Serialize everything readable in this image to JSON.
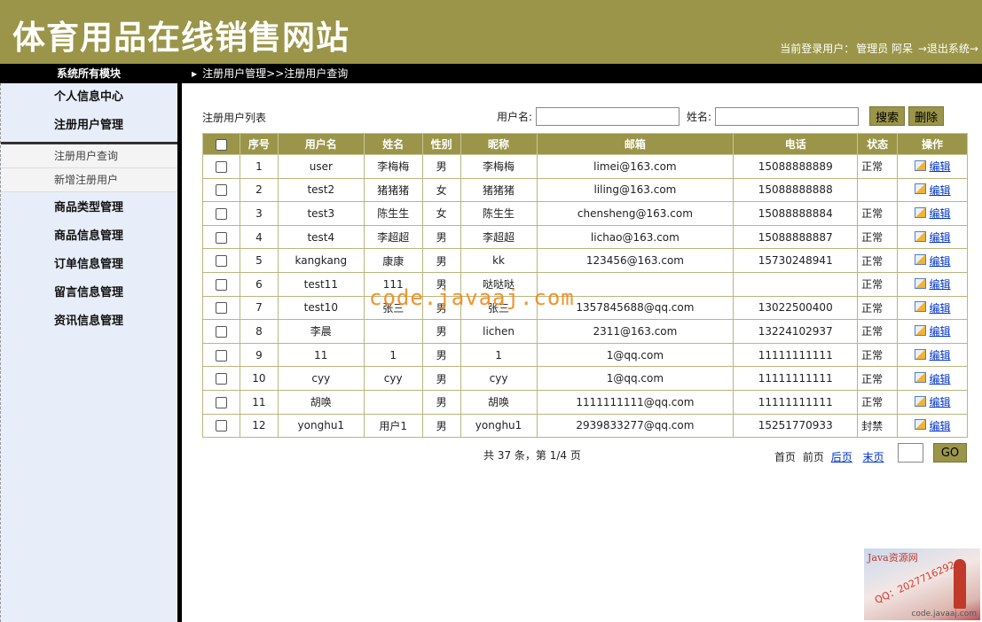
{
  "app": {
    "title": "体育用品在线销售网站",
    "login_label": "当前登录用户：",
    "login_user": "管理员 阿呆",
    "logout": "→退出系统→"
  },
  "nav": {
    "module_title": "系统所有模块",
    "breadcrumb": "注册用户管理>>注册用户查询"
  },
  "sidebar": {
    "groups_top": [
      "个人信息中心",
      "注册用户管理"
    ],
    "sub_items": [
      "注册用户查询",
      "新增注册用户"
    ],
    "groups_bottom": [
      "商品类型管理",
      "商品信息管理",
      "订单信息管理",
      "留言信息管理",
      "资讯信息管理"
    ]
  },
  "main": {
    "list_title": "注册用户列表",
    "search_username_label": "用户名:",
    "search_name_label": "姓名:",
    "search_username_value": "",
    "search_name_value": "",
    "search_button": "搜索",
    "delete_button": "删除"
  },
  "table": {
    "headers": [
      "",
      "序号",
      "用户名",
      "姓名",
      "性别",
      "昵称",
      "邮箱",
      "电话",
      "状态",
      "操作"
    ],
    "edit_label": "编辑",
    "rows": [
      [
        "1",
        "user",
        "李梅梅",
        "男",
        "李梅梅",
        "limei@163.com",
        "15088888889",
        "正常"
      ],
      [
        "2",
        "test2",
        "猪猪猪",
        "女",
        "猪猪猪",
        "liling@163.com",
        "15088888888",
        ""
      ],
      [
        "3",
        "test3",
        "陈生生",
        "女",
        "陈生生",
        "chensheng@163.com",
        "15088888884",
        "正常"
      ],
      [
        "4",
        "test4",
        "李超超",
        "男",
        "李超超",
        "lichao@163.com",
        "15088888887",
        "正常"
      ],
      [
        "5",
        "kangkang",
        "康康",
        "男",
        "kk",
        "123456@163.com",
        "15730248941",
        "正常"
      ],
      [
        "6",
        "test11",
        "111",
        "男",
        "哒哒哒",
        "",
        "",
        "正常"
      ],
      [
        "7",
        "test10",
        "张三",
        "男",
        "张三",
        "1357845688@qq.com",
        "13022500400",
        "正常"
      ],
      [
        "8",
        "李晨",
        "",
        "男",
        "lichen",
        "2311@163.com",
        "13224102937",
        "正常"
      ],
      [
        "9",
        "11",
        "1",
        "男",
        "1",
        "1@qq.com",
        "11111111111",
        "正常"
      ],
      [
        "10",
        "cyy",
        "cyy",
        "男",
        "cyy",
        "1@qq.com",
        "11111111111",
        "正常"
      ],
      [
        "11",
        "胡唤",
        "",
        "男",
        "胡唤",
        "1111111111@qq.com",
        "11111111111",
        "正常"
      ],
      [
        "12",
        "yonghu1",
        "用户1",
        "男",
        "yonghu1",
        "2939833277@qq.com",
        "15251770933",
        "封禁"
      ]
    ]
  },
  "pager": {
    "summary": "共 37 条，第 1/4 页",
    "first": "首页",
    "prev": "前页",
    "next": "后页",
    "last": "末页",
    "page_input_value": "",
    "go": "GO"
  },
  "watermark": {
    "text": "code.javaaj.com",
    "corner_title": "Java资源网",
    "corner_qq": "QQ：2027716292",
    "corner_url": "code.javaaj.com"
  },
  "colors": {
    "header_olive": "#9a9548",
    "sidebar_bg": "#e8eef9",
    "link_blue": "#0033cc",
    "watermark_orange": "#f08a1c"
  }
}
